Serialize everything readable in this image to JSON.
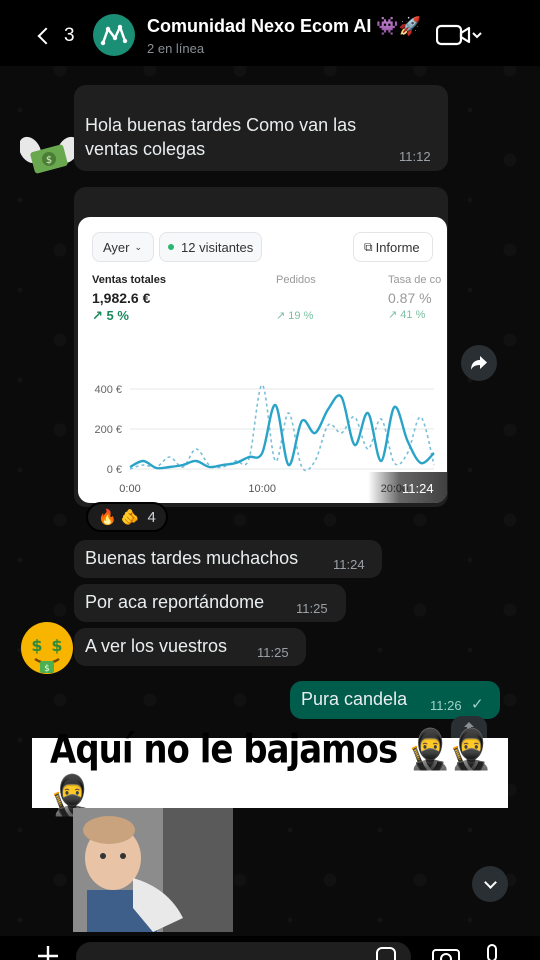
{
  "header": {
    "back_count": "3",
    "title": "Comunidad Nexo Ecom AI 👾🚀",
    "status": "2 en línea"
  },
  "messages": [
    {
      "text": "Hola buenas tardes Como van las ventas colegas",
      "time": "11:12"
    },
    {
      "text": "Buenas tardes muchachos",
      "time": "11:24"
    },
    {
      "text": "Por aca reportándome",
      "time": "11:25"
    },
    {
      "text": "A ver los vuestros",
      "time": "11:25"
    },
    {
      "text": "Pura candela",
      "time": "11:26",
      "status": "✓"
    }
  ],
  "image_message": {
    "time": "11:24",
    "reactions": {
      "emojis": "🔥 🫵",
      "count": "4"
    },
    "card": {
      "period": "Ayer",
      "visitors": "12 visitantes",
      "report_button": "Informe",
      "metrics": [
        {
          "label": "Ventas totales",
          "value": "1,982.6 €",
          "change": "↗ 5 %"
        },
        {
          "label": "Pedidos",
          "value": "",
          "change": "↗ 19 %"
        },
        {
          "label": "Tasa de co",
          "value": "0.87 %",
          "change": "↗ 41 %"
        }
      ]
    }
  },
  "chart_data": {
    "type": "line",
    "x_ticks": [
      "0:00",
      "10:00",
      "20:00"
    ],
    "y_ticks": [
      "400 €",
      "200 €",
      "0 €"
    ],
    "ylim": [
      0,
      450
    ],
    "x": [
      0,
      1,
      2,
      3,
      4,
      5,
      6,
      7,
      8,
      9,
      10,
      11,
      12,
      13,
      14,
      15,
      16,
      17,
      18,
      19,
      20,
      21,
      22,
      23
    ],
    "series": [
      {
        "values": [
          10,
          40,
          5,
          10,
          20,
          40,
          10,
          20,
          30,
          60,
          80,
          320,
          20,
          240,
          180,
          300,
          360,
          120,
          280,
          40,
          310,
          140,
          30,
          80
        ]
      },
      {
        "values": [
          0,
          20,
          10,
          60,
          10,
          100,
          20,
          10,
          40,
          50,
          420,
          40,
          280,
          10,
          40,
          220,
          180,
          260,
          100,
          250,
          30,
          80,
          260,
          20
        ]
      }
    ],
    "colors": [
      "#2aa3c9",
      "#79bfd8"
    ]
  },
  "meme": {
    "caption": "Aquí no le bajamos 🥷🥷🥷"
  },
  "colors": {
    "outgoing_bubble": "#005c4b",
    "incoming_bubble": "#1f1f1f",
    "avatar": "#1b8f76"
  }
}
